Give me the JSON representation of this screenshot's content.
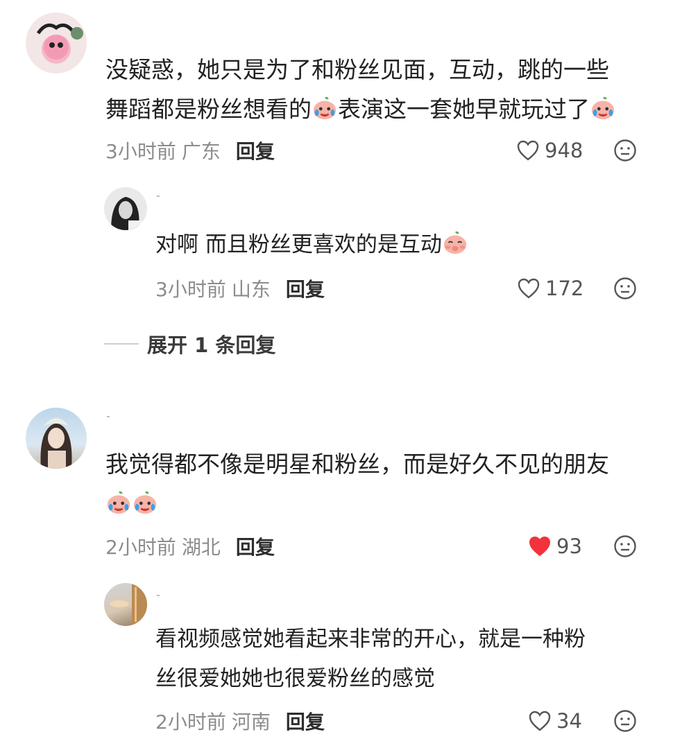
{
  "comments": [
    {
      "text_line1": "没疑惑，她只是为了和粉丝见面，互动，跳的一些",
      "text_line2a": "舞蹈都是粉丝想看的",
      "text_line2b": "表演这一套她早就玩过了",
      "time": "3小时前",
      "location": "广东",
      "reply_label": "回复",
      "likes": "948",
      "liked": false,
      "replies": [
        {
          "text": "对啊 而且粉丝更喜欢的是互动",
          "time": "3小时前",
          "location": "山东",
          "reply_label": "回复",
          "likes": "172",
          "liked": false
        }
      ],
      "expand_label": "展开 1 条回复"
    },
    {
      "text_line1": "我觉得都不像是明星和粉丝，而是好久不见的朋友",
      "time": "2小时前",
      "location": "湖北",
      "reply_label": "回复",
      "likes": "93",
      "liked": true,
      "replies": [
        {
          "text_line1": "看视频感觉她看起来非常的开心，就是一种粉",
          "text_line2": "丝很爱她她也很爱粉丝的感觉",
          "time": "2小时前",
          "location": "河南",
          "reply_label": "回复",
          "likes": "34",
          "liked": false
        }
      ]
    }
  ],
  "colors": {
    "like_red": "#f2323c",
    "meta_gray": "#8c8c8c"
  },
  "icons": [
    "heart-icon",
    "neutral-face-icon",
    "crying-emoji-icon",
    "shy-emoji-icon"
  ]
}
